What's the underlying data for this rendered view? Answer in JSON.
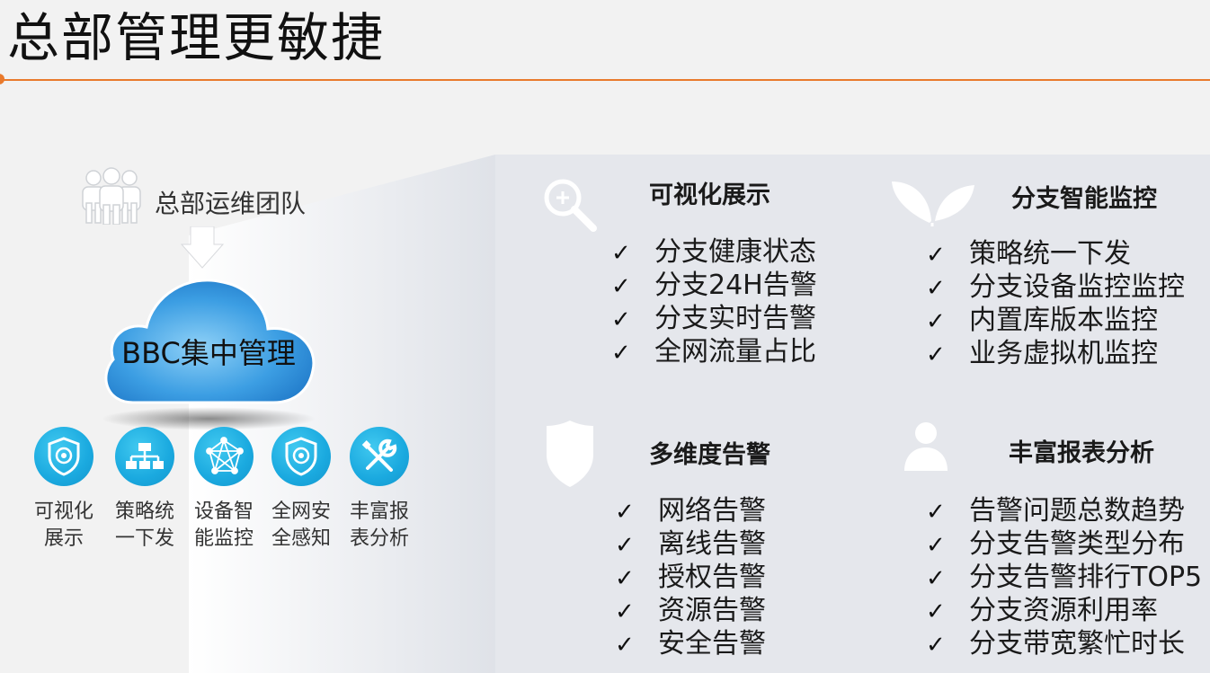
{
  "page_title": "总部管理更敏捷",
  "left": {
    "team_label": "总部运维团队",
    "cloud_label": "BBC集中管理",
    "features": [
      {
        "line1": "可视化",
        "line2": "展示",
        "icon": "shield-target-icon"
      },
      {
        "line1": "策略统",
        "line2": "一下发",
        "icon": "network-devices-icon"
      },
      {
        "line1": "设备智",
        "line2": "能监控",
        "icon": "network-graph-icon"
      },
      {
        "line1": "全网安",
        "line2": "全感知",
        "icon": "shield-target-icon"
      },
      {
        "line1": "丰富报",
        "line2": "表分析",
        "icon": "tools-icon"
      }
    ]
  },
  "check_mark": "✓",
  "sections": {
    "visual": {
      "title": "可视化展示",
      "icon": "magnifier-icon",
      "items": [
        "分支健康状态",
        "分支24H告警",
        "分支实时告警",
        "全网流量占比"
      ]
    },
    "monitor": {
      "title": "分支智能监控",
      "icon": "leaf-icon",
      "items": [
        "策略统一下发",
        "分支设备监控监控",
        "内置库版本监控",
        "业务虚拟机监控"
      ]
    },
    "alarm": {
      "title": "多维度告警",
      "icon": "shield-icon",
      "items": [
        "网络告警",
        "离线告警",
        "授权告警",
        "资源告警",
        "安全告警"
      ]
    },
    "report": {
      "title": "丰富报表分析",
      "icon": "user-icon",
      "items": [
        "告警问题总数趋势",
        "分支告警类型分布",
        "分支告警排行TOP5",
        "分支资源利用率",
        "分支带宽繁忙时长"
      ]
    }
  },
  "colors": {
    "accent": "#e97a2c",
    "icon_blue": "#1aa9df",
    "panel": "#e5e7ec"
  }
}
